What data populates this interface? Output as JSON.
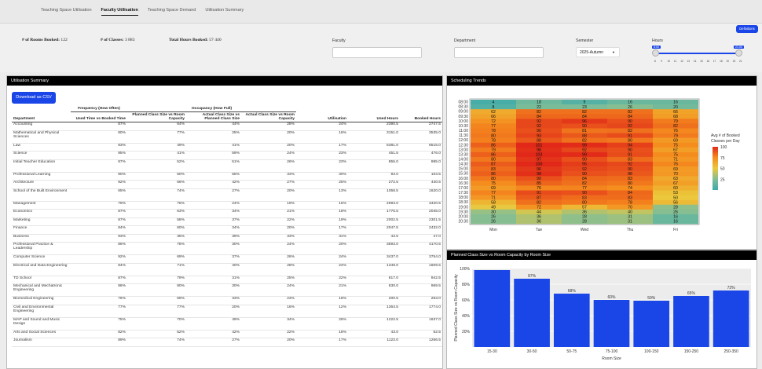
{
  "tabs": [
    {
      "label": "Teaching Space Utilisation",
      "active": false
    },
    {
      "label": "Faculty Utilisation",
      "active": true
    },
    {
      "label": "Teaching Space Demand",
      "active": false
    },
    {
      "label": "Utilisation Summary",
      "active": false
    }
  ],
  "stats": {
    "rooms_label": "# of Rooms Booked:",
    "rooms_value": "122",
    "classes_label": "# of Classes:",
    "classes_value": "3 883",
    "hours_label": "Total Hours Booked:",
    "hours_value": "57 440"
  },
  "filters": {
    "faculty_label": "Faculty",
    "faculty_value": "",
    "department_label": "Department",
    "department_value": "",
    "semester_label": "Semester",
    "semester_value": "2025-Autumn",
    "hours_label": "Hours",
    "hours_min": "8:00",
    "hours_max": "21:00",
    "hours_ticks": [
      "8",
      "9",
      "10",
      "11",
      "12",
      "13",
      "14",
      "15",
      "16",
      "17",
      "18",
      "19",
      "20",
      "21"
    ]
  },
  "definitions_label": "Definitions",
  "summary": {
    "title": "Utilisation Summary",
    "csv_label": "Download as CSV",
    "group_freq": "Frequency (How Often)",
    "group_occ": "Occupancy (How Full)",
    "columns": [
      "Department",
      "Used Time vs Booked Time",
      "Planned Class Size vs Room Capacity",
      "Actual Class Size vs Planned Class Size",
      "Actual Class Size vs Room Capacity",
      "Utilisation",
      "Used Hours",
      "Booked Hours"
    ],
    "rows": [
      [
        "Accounting",
        "87%",
        "64%",
        "44%",
        "28%",
        "24%",
        "2390.5",
        "2747.5"
      ],
      [
        "Mathematical and Physical Sciences",
        "80%",
        "77%",
        "25%",
        "20%",
        "16%",
        "3151.0",
        "3535.0"
      ],
      [
        "Law",
        "83%",
        "49%",
        "41%",
        "20%",
        "17%",
        "5381.0",
        "6515.0"
      ],
      [
        "Science",
        "95%",
        "41%",
        "59%",
        "24%",
        "23%",
        "451.5",
        "476.0"
      ],
      [
        "Initial Teacher Education",
        "87%",
        "52%",
        "51%",
        "26%",
        "23%",
        "855.0",
        "985.0"
      ],
      [
        "Professional Learning",
        "90%",
        "60%",
        "55%",
        "33%",
        "30%",
        "93.0",
        "103.5"
      ],
      [
        "Architecture",
        "92%",
        "66%",
        "42%",
        "27%",
        "25%",
        "272.5",
        "440.5"
      ],
      [
        "School of the Built Environment",
        "65%",
        "74%",
        "27%",
        "20%",
        "13%",
        "1058.5",
        "1620.0"
      ],
      [
        "Management",
        "79%",
        "76%",
        "24%",
        "19%",
        "15%",
        "2693.0",
        "3420.5"
      ],
      [
        "Economics",
        "87%",
        "63%",
        "34%",
        "21%",
        "18%",
        "1776.5",
        "2045.0"
      ],
      [
        "Marketing",
        "87%",
        "58%",
        "37%",
        "22%",
        "19%",
        "2002.5",
        "2301.5"
      ],
      [
        "Finance",
        "84%",
        "60%",
        "34%",
        "20%",
        "17%",
        "2047.5",
        "2432.0"
      ],
      [
        "Business",
        "93%",
        "35%",
        "39%",
        "33%",
        "31%",
        "43.5",
        "47.0"
      ],
      [
        "Professional Practice & Leadership",
        "86%",
        "78%",
        "30%",
        "24%",
        "20%",
        "3593.0",
        "4170.5"
      ],
      [
        "Computer Science",
        "92%",
        "69%",
        "37%",
        "26%",
        "24%",
        "3437.0",
        "3754.0"
      ],
      [
        "Electrical and Data Engineering",
        "84%",
        "71%",
        "40%",
        "28%",
        "24%",
        "1349.0",
        "1609.5"
      ],
      [
        "TD School",
        "87%",
        "79%",
        "31%",
        "25%",
        "22%",
        "817.0",
        "942.5"
      ],
      [
        "Mechanical and Mechatronic Engineering",
        "86%",
        "80%",
        "30%",
        "24%",
        "21%",
        "830.0",
        "969.5"
      ],
      [
        "Biomedical Engineering",
        "76%",
        "69%",
        "33%",
        "23%",
        "18%",
        "200.5",
        "263.0"
      ],
      [
        "Civil and Environmental Engineering",
        "77%",
        "77%",
        "20%",
        "16%",
        "12%",
        "1364.5",
        "1774.0"
      ],
      [
        "MAP and Sound and Music Design",
        "75%",
        "70%",
        "49%",
        "34%",
        "26%",
        "1222.5",
        "1637.0"
      ],
      [
        "Arts and Social Sciences",
        "82%",
        "52%",
        "42%",
        "22%",
        "18%",
        "43.0",
        "52.5"
      ],
      [
        "Journalism",
        "89%",
        "74%",
        "27%",
        "20%",
        "17%",
        "1123.0",
        "1266.5"
      ]
    ]
  },
  "heatmap": {
    "title": "Scheduling Trends",
    "legend_title": "Avg # of Booked Classes per Day",
    "legend_ticks": [
      "100",
      "75",
      "50",
      "25"
    ],
    "days": [
      "Mon",
      "Tue",
      "Wed",
      "Thu",
      "Fri"
    ],
    "times": [
      "08:00",
      "08:30",
      "09:00",
      "09:30",
      "10:00",
      "10:30",
      "11:00",
      "11:30",
      "12:00",
      "12:30",
      "13:00",
      "13:30",
      "14:00",
      "14:30",
      "15:00",
      "15:30",
      "16:00",
      "16:30",
      "17:00",
      "17:30",
      "18:00",
      "18:30",
      "19:00",
      "19:30",
      "20:00",
      "20:30"
    ],
    "values": [
      [
        4,
        18,
        9,
        16,
        16
      ],
      [
        8,
        22,
        23,
        26,
        20
      ],
      [
        62,
        82,
        82,
        82,
        66
      ],
      [
        66,
        84,
        84,
        84,
        68
      ],
      [
        72,
        92,
        96,
        90,
        79
      ],
      [
        77,
        92,
        90,
        92,
        82
      ],
      [
        78,
        90,
        81,
        82,
        76
      ],
      [
        80,
        93,
        88,
        91,
        79
      ],
      [
        78,
        88,
        82,
        80,
        69
      ],
      [
        86,
        101,
        99,
        94,
        75
      ],
      [
        79,
        98,
        92,
        90,
        67
      ],
      [
        86,
        103,
        99,
        91,
        75
      ],
      [
        80,
        97,
        90,
        83,
        71
      ],
      [
        87,
        100,
        95,
        92,
        76
      ],
      [
        83,
        96,
        92,
        90,
        69
      ],
      [
        86,
        98,
        90,
        88,
        70
      ],
      [
        80,
        90,
        84,
        83,
        63
      ],
      [
        75,
        85,
        82,
        80,
        67
      ],
      [
        69,
        76,
        77,
        74,
        60
      ],
      [
        77,
        91,
        90,
        84,
        53
      ],
      [
        71,
        87,
        83,
        83,
        50
      ],
      [
        58,
        82,
        80,
        78,
        56
      ],
      [
        49,
        72,
        57,
        70,
        28
      ],
      [
        30,
        44,
        36,
        40,
        26
      ],
      [
        26,
        36,
        28,
        31,
        16
      ],
      [
        26,
        36,
        28,
        31,
        16
      ]
    ]
  },
  "chart_data": {
    "type": "bar",
    "title": "Planned Class Size vs Room Capacity by Room Size",
    "categories": [
      "15-30",
      "30-50",
      "50-75",
      "75-100",
      "100-150",
      "150-250",
      "250-350"
    ],
    "values": [
      98,
      87,
      68,
      60,
      59,
      65,
      72
    ],
    "labels": [
      "",
      "87%",
      "68%",
      "60%",
      "59%",
      "65%",
      "72%"
    ],
    "xlabel": "Room Size",
    "ylabel": "Planned Class Size vs Room Capacity",
    "yticks": [
      "20%",
      "40%",
      "60%",
      "80%",
      "100%"
    ],
    "ylim": [
      0,
      100
    ],
    "bar_color": "#1a46e8"
  }
}
